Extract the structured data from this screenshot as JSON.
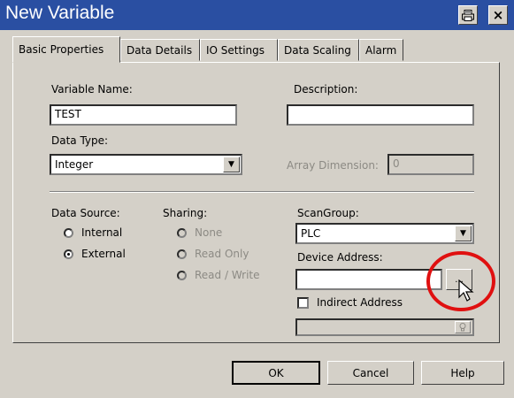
{
  "window": {
    "title": "New Variable",
    "print_icon": "printer-icon",
    "close_glyph": "×"
  },
  "tabs": [
    {
      "label": "Basic Properties",
      "active": true
    },
    {
      "label": "Data Details",
      "active": false
    },
    {
      "label": "IO Settings",
      "active": false
    },
    {
      "label": "Data Scaling",
      "active": false
    },
    {
      "label": "Alarm",
      "active": false
    }
  ],
  "basic": {
    "variable_name_label": "Variable Name:",
    "variable_name_value": "TEST",
    "description_label": "Description:",
    "description_value": "",
    "data_type_label": "Data Type:",
    "data_type_value": "Integer",
    "array_dimension_label": "Array Dimension:",
    "array_dimension_value": "0"
  },
  "source": {
    "label": "Data Source:",
    "options": [
      {
        "label": "Internal",
        "checked": false
      },
      {
        "label": "External",
        "checked": true
      }
    ]
  },
  "sharing": {
    "label": "Sharing:",
    "options": [
      {
        "label": "None"
      },
      {
        "label": "Read Only"
      },
      {
        "label": "Read / Write"
      }
    ]
  },
  "scan": {
    "group_label": "ScanGroup:",
    "group_value": "PLC",
    "device_address_label": "Device Address:",
    "device_address_value": "",
    "browse_label": "...",
    "indirect_label": "Indirect Address",
    "indirect_checked": false,
    "indirect_value": ""
  },
  "footer": {
    "ok": "OK",
    "cancel": "Cancel",
    "help": "Help"
  },
  "colors": {
    "titlebar": "#2a4fa2",
    "dialog": "#d4d0c8",
    "highlight_circle": "#e01010"
  }
}
